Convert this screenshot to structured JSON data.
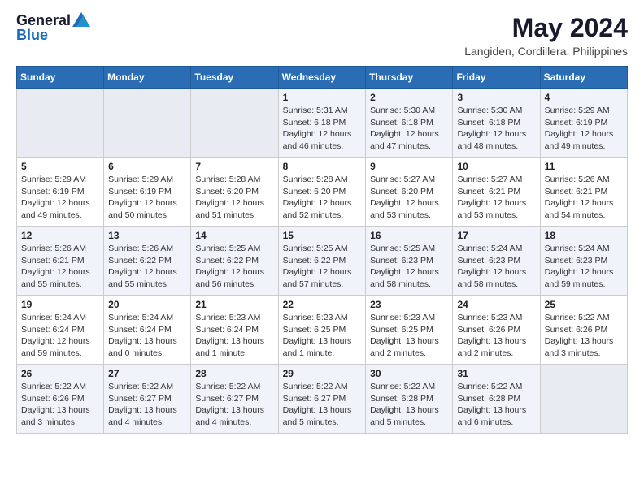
{
  "header": {
    "logo_general": "General",
    "logo_blue": "Blue",
    "month_year": "May 2024",
    "location": "Langiden, Cordillera, Philippines"
  },
  "weekdays": [
    "Sunday",
    "Monday",
    "Tuesday",
    "Wednesday",
    "Thursday",
    "Friday",
    "Saturday"
  ],
  "weeks": [
    [
      {
        "day": "",
        "info": ""
      },
      {
        "day": "",
        "info": ""
      },
      {
        "day": "",
        "info": ""
      },
      {
        "day": "1",
        "info": "Sunrise: 5:31 AM\nSunset: 6:18 PM\nDaylight: 12 hours\nand 46 minutes."
      },
      {
        "day": "2",
        "info": "Sunrise: 5:30 AM\nSunset: 6:18 PM\nDaylight: 12 hours\nand 47 minutes."
      },
      {
        "day": "3",
        "info": "Sunrise: 5:30 AM\nSunset: 6:18 PM\nDaylight: 12 hours\nand 48 minutes."
      },
      {
        "day": "4",
        "info": "Sunrise: 5:29 AM\nSunset: 6:19 PM\nDaylight: 12 hours\nand 49 minutes."
      }
    ],
    [
      {
        "day": "5",
        "info": "Sunrise: 5:29 AM\nSunset: 6:19 PM\nDaylight: 12 hours\nand 49 minutes."
      },
      {
        "day": "6",
        "info": "Sunrise: 5:29 AM\nSunset: 6:19 PM\nDaylight: 12 hours\nand 50 minutes."
      },
      {
        "day": "7",
        "info": "Sunrise: 5:28 AM\nSunset: 6:20 PM\nDaylight: 12 hours\nand 51 minutes."
      },
      {
        "day": "8",
        "info": "Sunrise: 5:28 AM\nSunset: 6:20 PM\nDaylight: 12 hours\nand 52 minutes."
      },
      {
        "day": "9",
        "info": "Sunrise: 5:27 AM\nSunset: 6:20 PM\nDaylight: 12 hours\nand 53 minutes."
      },
      {
        "day": "10",
        "info": "Sunrise: 5:27 AM\nSunset: 6:21 PM\nDaylight: 12 hours\nand 53 minutes."
      },
      {
        "day": "11",
        "info": "Sunrise: 5:26 AM\nSunset: 6:21 PM\nDaylight: 12 hours\nand 54 minutes."
      }
    ],
    [
      {
        "day": "12",
        "info": "Sunrise: 5:26 AM\nSunset: 6:21 PM\nDaylight: 12 hours\nand 55 minutes."
      },
      {
        "day": "13",
        "info": "Sunrise: 5:26 AM\nSunset: 6:22 PM\nDaylight: 12 hours\nand 55 minutes."
      },
      {
        "day": "14",
        "info": "Sunrise: 5:25 AM\nSunset: 6:22 PM\nDaylight: 12 hours\nand 56 minutes."
      },
      {
        "day": "15",
        "info": "Sunrise: 5:25 AM\nSunset: 6:22 PM\nDaylight: 12 hours\nand 57 minutes."
      },
      {
        "day": "16",
        "info": "Sunrise: 5:25 AM\nSunset: 6:23 PM\nDaylight: 12 hours\nand 58 minutes."
      },
      {
        "day": "17",
        "info": "Sunrise: 5:24 AM\nSunset: 6:23 PM\nDaylight: 12 hours\nand 58 minutes."
      },
      {
        "day": "18",
        "info": "Sunrise: 5:24 AM\nSunset: 6:23 PM\nDaylight: 12 hours\nand 59 minutes."
      }
    ],
    [
      {
        "day": "19",
        "info": "Sunrise: 5:24 AM\nSunset: 6:24 PM\nDaylight: 12 hours\nand 59 minutes."
      },
      {
        "day": "20",
        "info": "Sunrise: 5:24 AM\nSunset: 6:24 PM\nDaylight: 13 hours\nand 0 minutes."
      },
      {
        "day": "21",
        "info": "Sunrise: 5:23 AM\nSunset: 6:24 PM\nDaylight: 13 hours\nand 1 minute."
      },
      {
        "day": "22",
        "info": "Sunrise: 5:23 AM\nSunset: 6:25 PM\nDaylight: 13 hours\nand 1 minute."
      },
      {
        "day": "23",
        "info": "Sunrise: 5:23 AM\nSunset: 6:25 PM\nDaylight: 13 hours\nand 2 minutes."
      },
      {
        "day": "24",
        "info": "Sunrise: 5:23 AM\nSunset: 6:26 PM\nDaylight: 13 hours\nand 2 minutes."
      },
      {
        "day": "25",
        "info": "Sunrise: 5:22 AM\nSunset: 6:26 PM\nDaylight: 13 hours\nand 3 minutes."
      }
    ],
    [
      {
        "day": "26",
        "info": "Sunrise: 5:22 AM\nSunset: 6:26 PM\nDaylight: 13 hours\nand 3 minutes."
      },
      {
        "day": "27",
        "info": "Sunrise: 5:22 AM\nSunset: 6:27 PM\nDaylight: 13 hours\nand 4 minutes."
      },
      {
        "day": "28",
        "info": "Sunrise: 5:22 AM\nSunset: 6:27 PM\nDaylight: 13 hours\nand 4 minutes."
      },
      {
        "day": "29",
        "info": "Sunrise: 5:22 AM\nSunset: 6:27 PM\nDaylight: 13 hours\nand 5 minutes."
      },
      {
        "day": "30",
        "info": "Sunrise: 5:22 AM\nSunset: 6:28 PM\nDaylight: 13 hours\nand 5 minutes."
      },
      {
        "day": "31",
        "info": "Sunrise: 5:22 AM\nSunset: 6:28 PM\nDaylight: 13 hours\nand 6 minutes."
      },
      {
        "day": "",
        "info": ""
      }
    ]
  ]
}
